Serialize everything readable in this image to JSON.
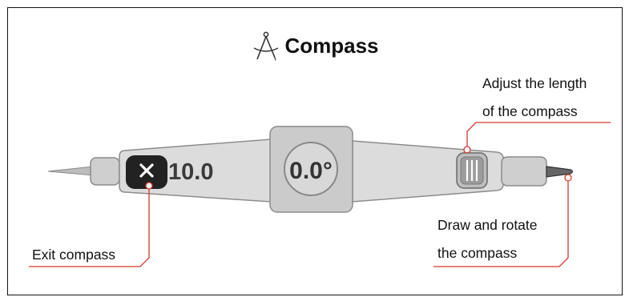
{
  "title": "Compass",
  "title_icon": "compass-drafting-icon",
  "compass": {
    "length_value": "10.0",
    "angle_value": "0.0°",
    "close_icon": "close-x-icon",
    "adjust_handle_icon": "grip-lines-icon"
  },
  "callouts": {
    "exit": "Exit compass",
    "adjust_line1": "Adjust the length",
    "adjust_line2": "of the compass",
    "draw_line1": "Draw and rotate",
    "draw_line2": "the compass"
  },
  "colors": {
    "callout_line": "#d6372e",
    "body_fill": "#dcdcdc",
    "body_stroke": "#8c8c8c",
    "text_dark": "#333333",
    "close_button": "#222222"
  }
}
